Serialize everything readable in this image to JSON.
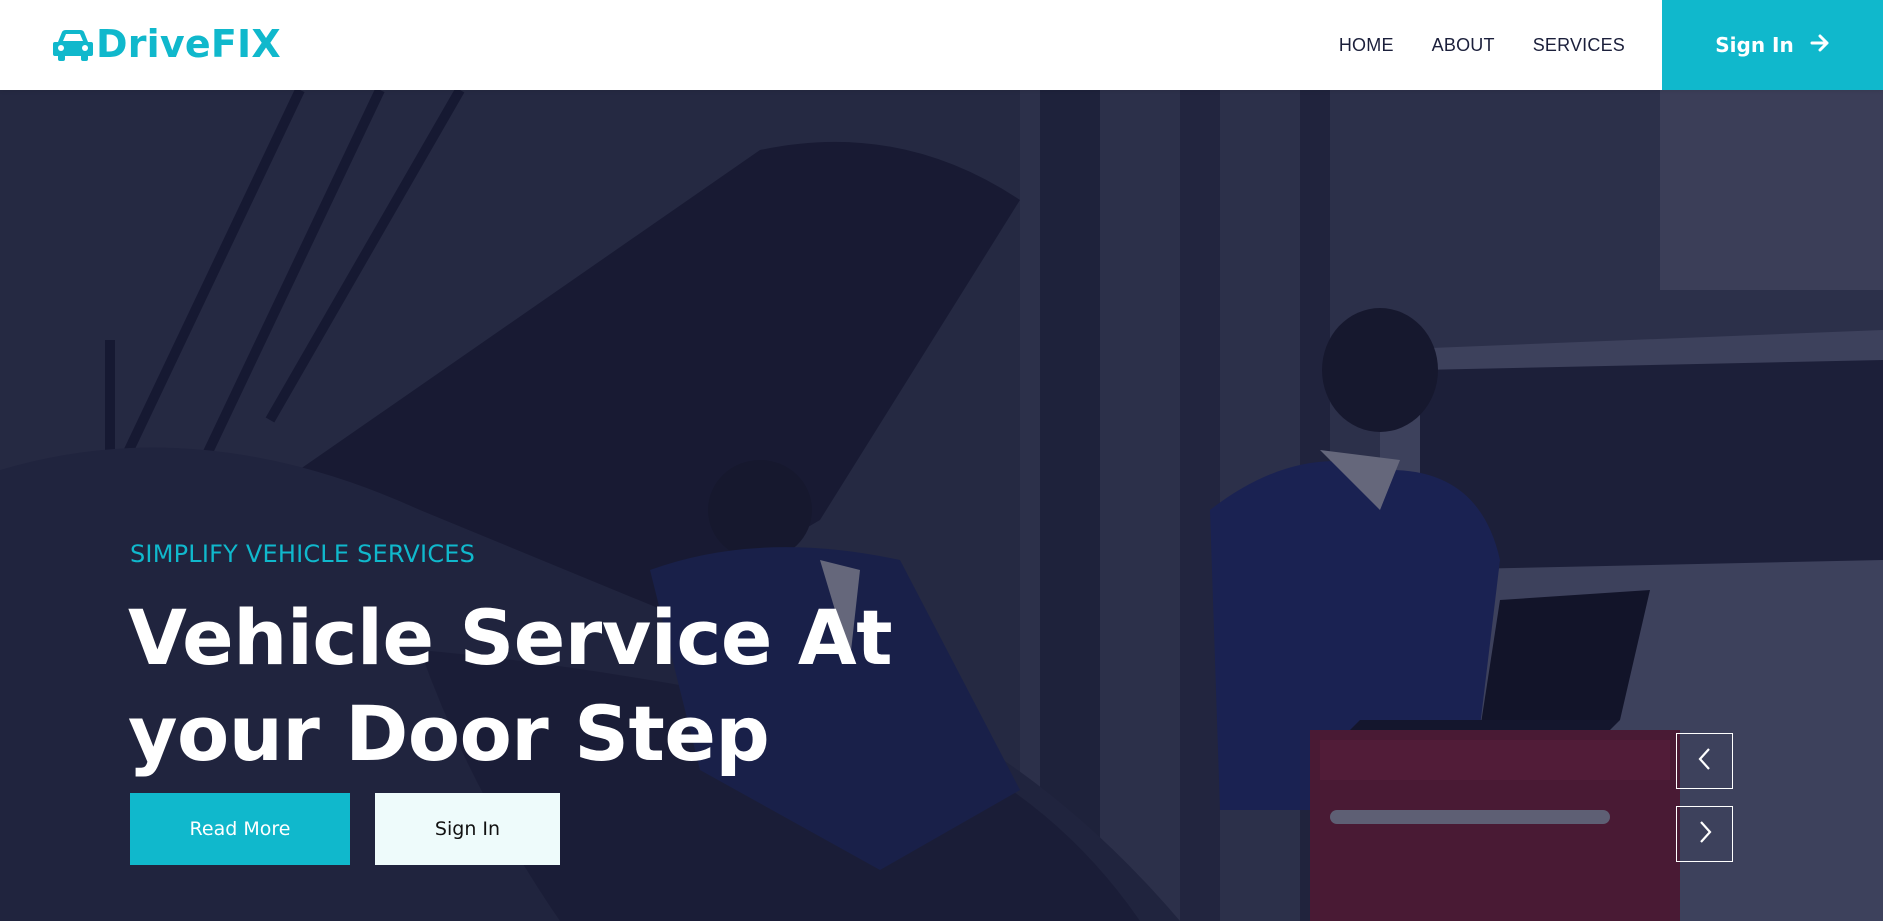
{
  "brand": {
    "name": "DriveFIX",
    "logo_icon": "car-icon",
    "color": "#10b8cc"
  },
  "nav": {
    "items": [
      {
        "label": "HOME"
      },
      {
        "label": "ABOUT"
      },
      {
        "label": "SERVICES"
      }
    ],
    "signin_label": "Sign In",
    "signin_icon": "arrow-right-icon"
  },
  "hero": {
    "subtitle": "SIMPLIFY VEHICLE SERVICES",
    "title": "Vehicle Service At your Door Step",
    "read_more_label": "Read More",
    "signin_label": "Sign In",
    "prev_icon": "chevron-left-icon",
    "next_icon": "chevron-right-icon"
  },
  "colors": {
    "accent": "#10b8cc",
    "overlay": "#14163280",
    "text_dark": "#1b1f3b"
  }
}
